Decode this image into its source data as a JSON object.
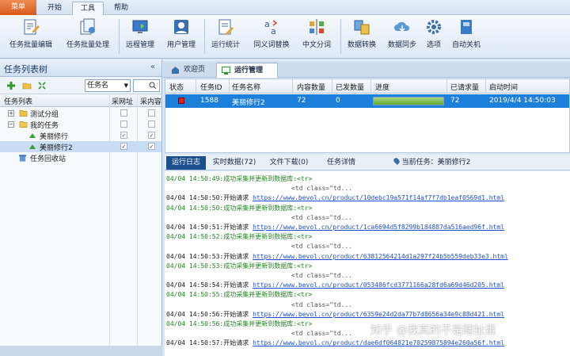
{
  "menubar": {
    "main_button": "菜单",
    "tabs": [
      "开始",
      "工具",
      "帮助"
    ],
    "active_tab": "工具"
  },
  "ribbon": {
    "buttons": [
      "任务批量编辑",
      "任务批量处理",
      "远程管理",
      "用户管理",
      "运行统计",
      "同义词替换",
      "中文分词",
      "数据转换",
      "数据同步",
      "选项",
      "自动关机"
    ]
  },
  "left_panel": {
    "title": "任务列表树",
    "collapse_glyph": "«",
    "filter_select": "任务名",
    "columns": [
      "任务列表",
      "采网址",
      "采内容"
    ],
    "tree": [
      {
        "label": "测试分组",
        "expander": "+",
        "col1": false,
        "col2": false
      },
      {
        "label": "我的任务",
        "expander": "−",
        "col1": false,
        "col2": false
      },
      {
        "label": "美丽修行",
        "col1": true,
        "col2": true
      },
      {
        "label": "美丽修行2",
        "col1": true,
        "col2": true,
        "selected": true
      },
      {
        "label": "任务回收站"
      }
    ]
  },
  "doc_tabs": [
    "欢迎页",
    "运行管理"
  ],
  "run_grid": {
    "columns": [
      "状态",
      "任务ID",
      "任务名称",
      "内容数量",
      "已发数量",
      "进度",
      "已请求量",
      "启动时间"
    ],
    "row": {
      "task_id": "1588",
      "task_name": "美丽修行2",
      "content_count": "72",
      "sent_count": "0",
      "progress": 1.0,
      "requested": "72",
      "start_time": "2019/4/4 14:50:03"
    }
  },
  "detail_tabs": [
    "运行日志",
    "实时数据(72)",
    "文件下载(0)",
    "任务详情",
    "当前任务：美丽修行2"
  ],
  "log": [
    {
      "ts": "04/04 14:50:49:",
      "msg": "成功采集并更新到数据库:<tr>",
      "type": "ok"
    },
    {
      "indent": "<td class=\"td..."
    },
    {
      "ts": "04/04 14:50:50:",
      "msg": "开始请求",
      "url": "https://www.bevol.cn/product/10debc19a571f14af7f7db1eaf0569d1.html",
      "type": "req"
    },
    {
      "ts": "04/04 14:50:50:",
      "msg": "成功采集并更新到数据库:<tr>",
      "type": "ok"
    },
    {
      "indent": "<td class=\"td..."
    },
    {
      "ts": "04/04 14:50:51:",
      "msg": "开始请求",
      "url": "https://www.bevol.cn/product/1ca6694d5f8299b184887da516aed96f.html",
      "type": "req"
    },
    {
      "ts": "04/04 14:50:52:",
      "msg": "成功采集并更新到数据库:<tr>",
      "type": "ok"
    },
    {
      "indent": "<td class=\"td..."
    },
    {
      "ts": "04/04 14:50:53:",
      "msg": "开始请求",
      "url": "https://www.bevol.cn/product/63812564214d1a297f24b5b559deb33e3.html",
      "type": "req"
    },
    {
      "ts": "04/04 14:50:53:",
      "msg": "成功采集并更新到数据库:<tr>",
      "type": "ok"
    },
    {
      "indent": "<td class=\"td..."
    },
    {
      "ts": "04/04 14:50:54:",
      "msg": "开始请求",
      "url": "https://www.bevol.cn/product/053486fcd3771166a28fd6a69d46d205.html",
      "type": "req"
    },
    {
      "ts": "04/04 14:50:55:",
      "msg": "成功采集并更新到数据库:<tr>",
      "type": "ok"
    },
    {
      "indent": "<td class=\"td..."
    },
    {
      "ts": "04/04 14:50:56:",
      "msg": "开始请求",
      "url": "https://www.bevol.cn/product/6359e24d2da77b7d8656a34e9c88d421.html",
      "type": "req"
    },
    {
      "ts": "04/04 14:50:56:",
      "msg": "成功采集并更新到数据库:<tr>",
      "type": "ok"
    },
    {
      "indent": "<td class=\"td..."
    },
    {
      "ts": "04/04 14:50:57:",
      "msg": "开始请求",
      "url": "https://www.bevol.cn/product/dae6df064821e70259875894e260a56f.html",
      "type": "req"
    }
  ],
  "watermark": "知乎 @我真的不是瞎扯蛋",
  "colors": {
    "accent": "#1c7fd9",
    "menu_orange": "#e0662a",
    "ok_green": "#1c8a1c",
    "link_blue": "#1f4fd1"
  }
}
